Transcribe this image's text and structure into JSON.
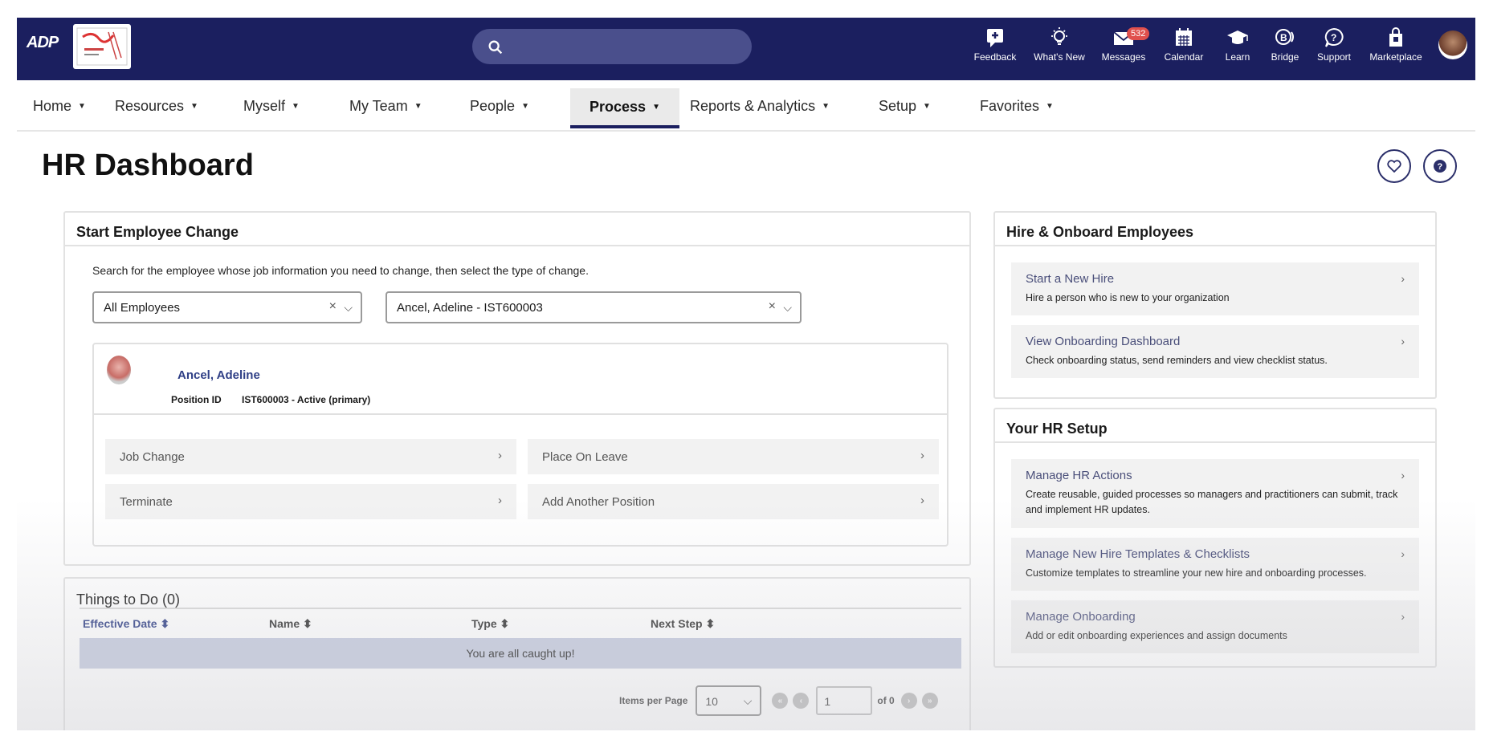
{
  "topbar": {
    "logo_text": "ADP",
    "search": {
      "placeholder": ""
    },
    "items": [
      {
        "label": "Feedback"
      },
      {
        "label": "What's New"
      },
      {
        "label": "Messages",
        "badge": "532"
      },
      {
        "label": "Calendar"
      },
      {
        "label": "Learn"
      },
      {
        "label": "Bridge"
      },
      {
        "label": "Support"
      },
      {
        "label": "Marketplace"
      }
    ]
  },
  "nav": [
    "Home",
    "Resources",
    "Myself",
    "My Team",
    "People",
    "Process",
    "Reports & Analytics",
    "Setup",
    "Favorites"
  ],
  "page": {
    "title": "HR Dashboard"
  },
  "employee_change": {
    "title": "Start Employee Change",
    "hint": "Search for the employee whose job information you need to change, then select the type of change.",
    "filter_value": "All Employees",
    "employee_value": "Ancel, Adeline - IST600003",
    "employee_name": "Ancel, Adeline",
    "position_label": "Position ID",
    "position_value": "IST600003 - Active (primary)",
    "actions": [
      "Job Change",
      "Place On Leave",
      "Terminate",
      "Add Another Position"
    ]
  },
  "todo": {
    "title": "Things to Do (0)",
    "columns": [
      "Effective Date ⬍",
      "Name ⬍",
      "Type ⬍",
      "Next Step ⬍"
    ],
    "empty": "You are all caught up!",
    "items_per_page_label": "Items per Page",
    "items_per_page": "10",
    "page": "1",
    "of_label": "of 0"
  },
  "hire": {
    "title": "Hire & Onboard Employees",
    "items": [
      {
        "title": "Start a New Hire",
        "desc": "Hire a person who is new to your organization"
      },
      {
        "title": "View Onboarding Dashboard",
        "desc": "Check onboarding status, send reminders and view checklist status."
      }
    ]
  },
  "setup": {
    "title": "Your HR Setup",
    "items": [
      {
        "title": "Manage HR Actions",
        "desc": "Create reusable, guided processes so managers and practitioners can submit, track and implement HR updates."
      },
      {
        "title": "Manage New Hire Templates & Checklists",
        "desc": "Customize templates to streamline your new hire and onboarding processes."
      },
      {
        "title": "Manage Onboarding",
        "desc": "Add or edit onboarding experiences and assign documents"
      }
    ]
  }
}
